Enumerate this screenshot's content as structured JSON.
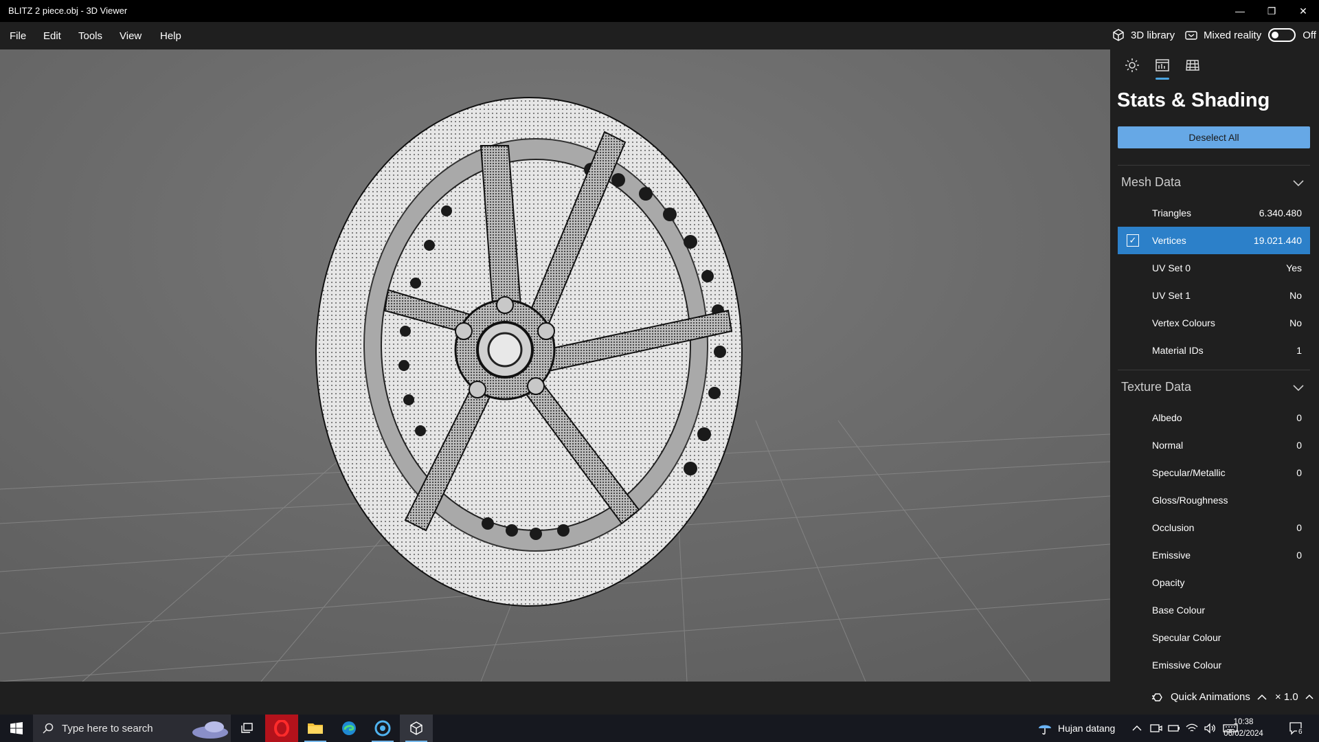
{
  "window": {
    "title": "BLITZ 2 piece.obj - 3D Viewer",
    "minimize": "—",
    "restore": "❐",
    "close": "✕"
  },
  "menu": {
    "items": [
      "File",
      "Edit",
      "Tools",
      "View",
      "Help"
    ],
    "library_label": "3D library",
    "mixed_reality_label": "Mixed reality",
    "mixed_reality_state": "Off"
  },
  "panel": {
    "tabs": [
      "lighting-icon",
      "stats-icon",
      "grid-icon"
    ],
    "title": "Stats & Shading",
    "deselect_label": "Deselect All",
    "mesh_header": "Mesh Data",
    "mesh_rows": [
      {
        "label": "Triangles",
        "value": "6.340.480"
      },
      {
        "label": "Vertices",
        "value": "19.021.440",
        "selected": true
      },
      {
        "label": "UV Set 0",
        "value": "Yes"
      },
      {
        "label": "UV Set 1",
        "value": "No"
      },
      {
        "label": "Vertex Colours",
        "value": "No"
      },
      {
        "label": "Material IDs",
        "value": "1"
      }
    ],
    "texture_header": "Texture Data",
    "texture_rows": [
      {
        "label": "Albedo",
        "value": "0"
      },
      {
        "label": "Normal",
        "value": "0"
      },
      {
        "label": "Specular/Metallic",
        "value": "0"
      },
      {
        "label": "Gloss/Roughness",
        "value": ""
      },
      {
        "label": "Occlusion",
        "value": "0"
      },
      {
        "label": "Emissive",
        "value": "0"
      },
      {
        "label": "Opacity",
        "value": ""
      },
      {
        "label": "Base Colour",
        "value": ""
      },
      {
        "label": "Specular Colour",
        "value": ""
      },
      {
        "label": "Emissive Colour",
        "value": ""
      }
    ]
  },
  "bottom": {
    "quick_animations": "Quick Animations",
    "speed": "× 1.0"
  },
  "taskbar": {
    "search_placeholder": "Type here to search",
    "weather": "Hujan datang",
    "time": "10:38",
    "date": "06/02/2024",
    "notifications": "6"
  },
  "colors": {
    "accent": "#66a8e6",
    "selected_row": "#2c80c9",
    "viewport_bg": "#6c6c6c"
  }
}
